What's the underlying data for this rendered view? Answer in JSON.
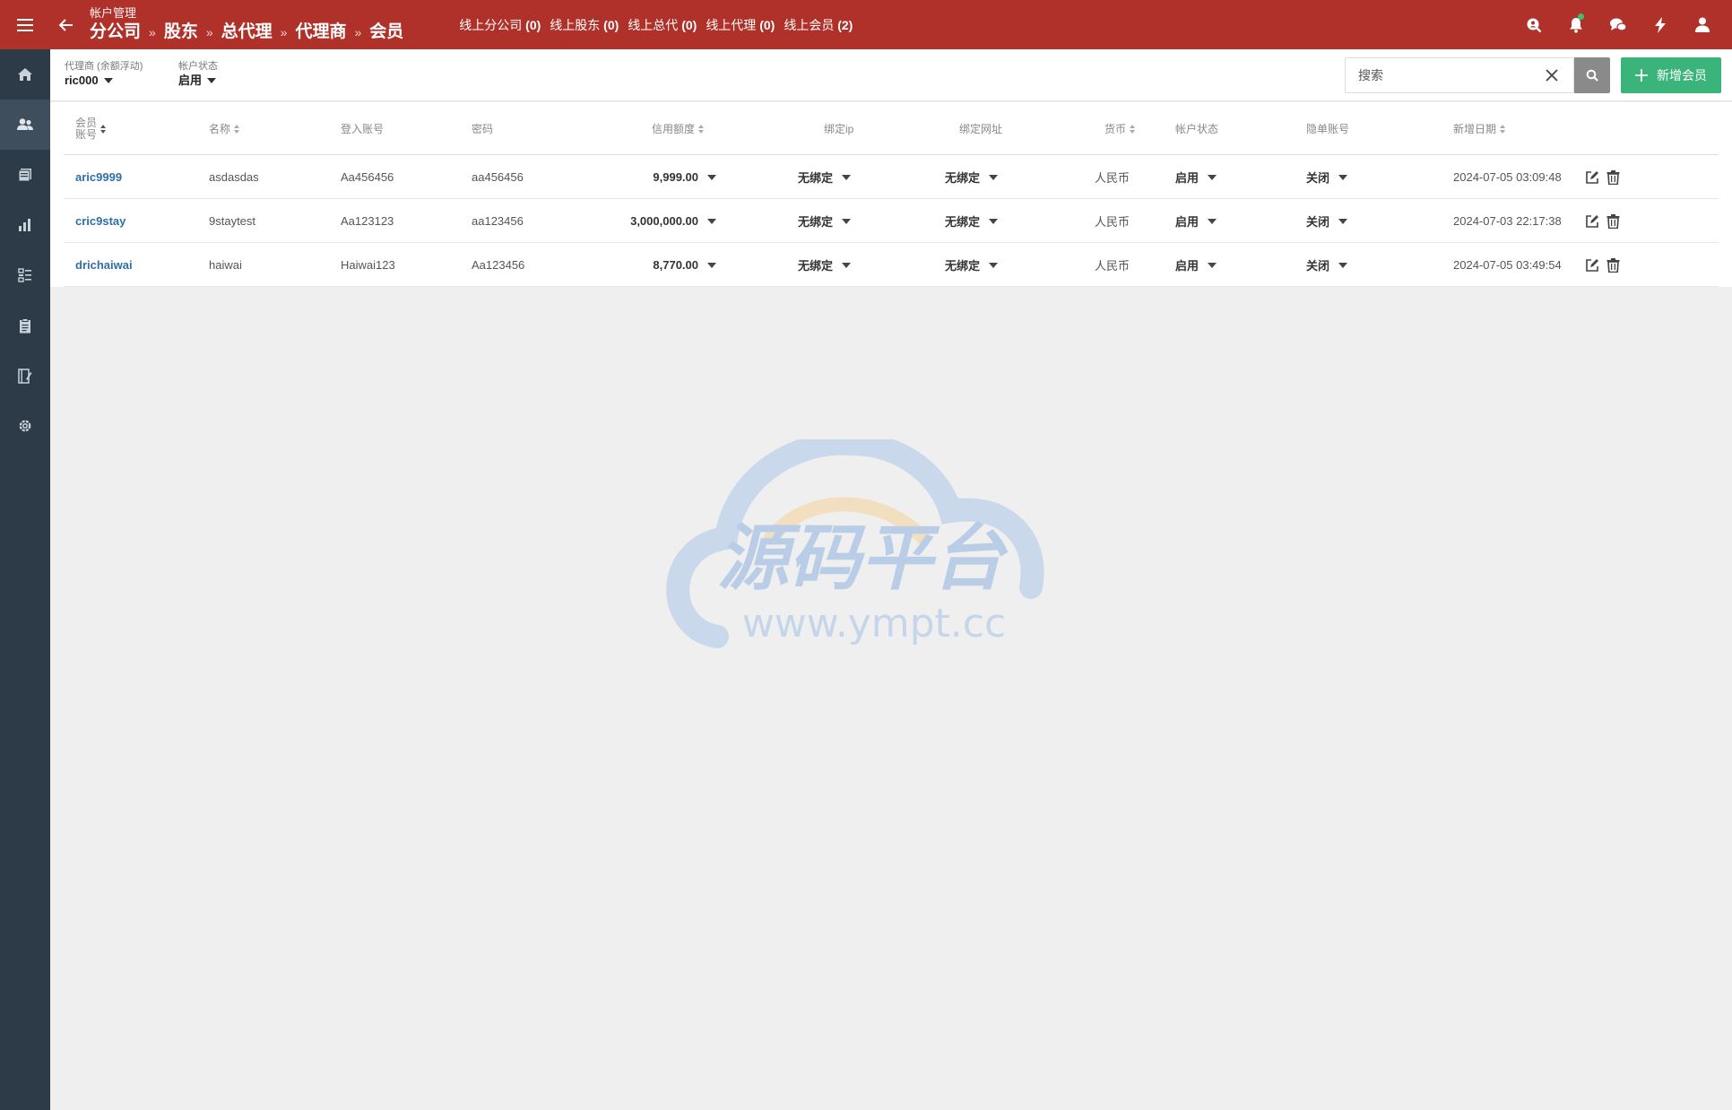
{
  "header": {
    "section": "帐户管理",
    "breadcrumbs": [
      "分公司",
      "股东",
      "总代理",
      "代理商",
      "会员"
    ],
    "separator": "»",
    "online": [
      {
        "label": "线上分公司",
        "count": "(0)"
      },
      {
        "label": "线上股东",
        "count": "(0)"
      },
      {
        "label": "线上总代",
        "count": "(0)"
      },
      {
        "label": "线上代理",
        "count": "(0)"
      },
      {
        "label": "线上会员",
        "count": "(2)"
      }
    ]
  },
  "filters": {
    "agent": {
      "label": "代理商 (余额浮动)",
      "value": "ric000"
    },
    "status": {
      "label": "帐户状态",
      "value": "启用"
    }
  },
  "search": {
    "placeholder": "搜索",
    "value": ""
  },
  "add_button": {
    "label": "新增会员"
  },
  "table": {
    "headers": {
      "account_line1": "会员",
      "account_line2": "账号",
      "name": "名称",
      "login": "登入账号",
      "password": "密码",
      "credit": "信用额度",
      "bind_ip": "绑定ip",
      "bind_url": "绑定网址",
      "currency": "货币",
      "status": "帐户状态",
      "hidden": "隐单账号",
      "date": "新增日期"
    },
    "rows": [
      {
        "account": "aric9999",
        "name": "asdasdas",
        "login": "Aa456456",
        "password": "aa456456",
        "credit": "9,999.00",
        "bind_ip": "无绑定",
        "bind_url": "无绑定",
        "currency": "人民币",
        "status": "启用",
        "hidden": "关闭",
        "date": "2024-07-05 03:09:48"
      },
      {
        "account": "cric9stay",
        "name": "9staytest",
        "login": "Aa123123",
        "password": "aa123456",
        "credit": "3,000,000.00",
        "bind_ip": "无绑定",
        "bind_url": "无绑定",
        "currency": "人民币",
        "status": "启用",
        "hidden": "关闭",
        "date": "2024-07-03 22:17:38"
      },
      {
        "account": "drichaiwai",
        "name": "haiwai",
        "login": "Haiwai123",
        "password": "Aa123456",
        "credit": "8,770.00",
        "bind_ip": "无绑定",
        "bind_url": "无绑定",
        "currency": "人民币",
        "status": "启用",
        "hidden": "关闭",
        "date": "2024-07-05 03:49:54"
      }
    ]
  },
  "watermark": {
    "title": "源码平台",
    "url": "www.ympt.cc"
  },
  "colors": {
    "topbar": "#b0302a",
    "sidebar": "#2d3a47",
    "accent_green": "#3bb47c",
    "link": "#2f6fa7"
  }
}
